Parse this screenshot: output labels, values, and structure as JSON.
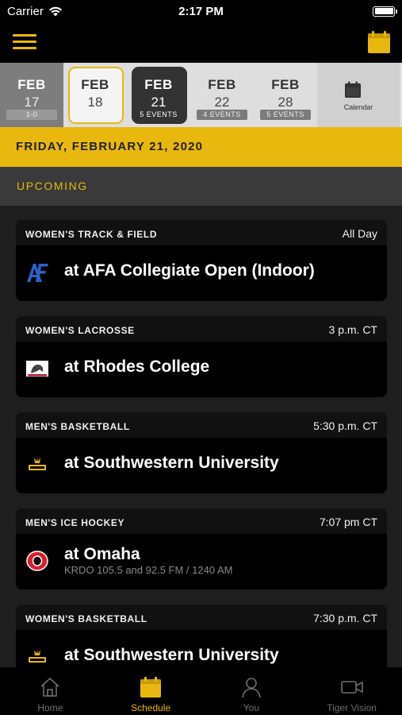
{
  "status_bar": {
    "carrier": "Carrier",
    "time": "2:17 PM"
  },
  "date_strip": {
    "cells": [
      {
        "month": "FEB",
        "day": "17",
        "count": "1-0"
      },
      {
        "month": "FEB",
        "day": "18",
        "count": ""
      },
      {
        "month": "FEB",
        "day": "21",
        "count": "5 EVENTS"
      },
      {
        "month": "FEB",
        "day": "22",
        "count": "4 EVENTS"
      },
      {
        "month": "FEB",
        "day": "28",
        "count": "5 EVENTS"
      }
    ],
    "calendar_label": "Calendar"
  },
  "date_banner": "FRIDAY, FEBRUARY 21, 2020",
  "section_header": "UPCOMING",
  "events": [
    {
      "sport": "WOMEN'S TRACK & FIELD",
      "time": "All Day",
      "opponent": "at AFA Collegiate Open (Indoor)",
      "radio": "",
      "logo": "air-force-logo"
    },
    {
      "sport": "WOMEN'S LACROSSE",
      "time": "3 p.m. CT",
      "opponent": "at Rhodes College",
      "radio": "",
      "logo": "rhodes-logo"
    },
    {
      "sport": "MEN'S BASKETBALL",
      "time": "5:30 p.m. CT",
      "opponent": "at Southwestern University",
      "radio": "",
      "logo": "pirates-logo"
    },
    {
      "sport": "MEN'S ICE HOCKEY",
      "time": "7:07 pm CT",
      "opponent": "at Omaha",
      "radio": "KRDO 105.5 and 92.5 FM / 1240 AM",
      "logo": "omaha-logo"
    },
    {
      "sport": "WOMEN'S BASKETBALL",
      "time": "7:30 p.m. CT",
      "opponent": "at Southwestern University",
      "radio": "",
      "logo": "pirates-logo"
    }
  ],
  "tabs": [
    {
      "label": "Home",
      "icon": "home-icon"
    },
    {
      "label": "Schedule",
      "icon": "calendar-icon"
    },
    {
      "label": "You",
      "icon": "person-icon"
    },
    {
      "label": "Tiger Vision",
      "icon": "video-camera-icon"
    }
  ],
  "colors": {
    "accent": "#e8b80e",
    "background": "#1b1b1b",
    "card": "#000000"
  }
}
